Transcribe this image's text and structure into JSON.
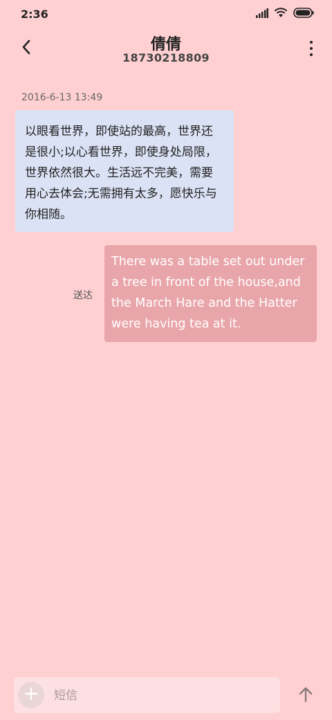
{
  "status_bar": {
    "time": "2:36",
    "icons": [
      "signal-icon",
      "wifi-icon",
      "battery-icon"
    ]
  },
  "header": {
    "contact_name": "倩倩",
    "contact_number": "18730218809",
    "back_icon": "back-arrow-icon",
    "more_icon": "more-vertical-icon"
  },
  "messages": [
    {
      "direction": "incoming",
      "timestamp": "2016-6-13 13:49",
      "text": "以眼看世界，即使站的最高，世界还是很小;以心看世界，即使身处局限，世界依然很大。生活远不完美，需要用心去体会;无需拥有太多，愿快乐与你相随。"
    },
    {
      "direction": "outgoing",
      "status": "送达",
      "text": "There was a table set out under a tree in front of the house,and the March Hare and the Hatter were having tea at it."
    }
  ],
  "composer": {
    "placeholder": "短信",
    "add_icon": "plus-icon",
    "send_icon": "send-arrow-up-icon"
  },
  "colors": {
    "background": "#ffd0d2",
    "incoming_bubble": "#dbe2f5",
    "outgoing_bubble": "#e9a6aa",
    "composer": "#fde0e1"
  }
}
